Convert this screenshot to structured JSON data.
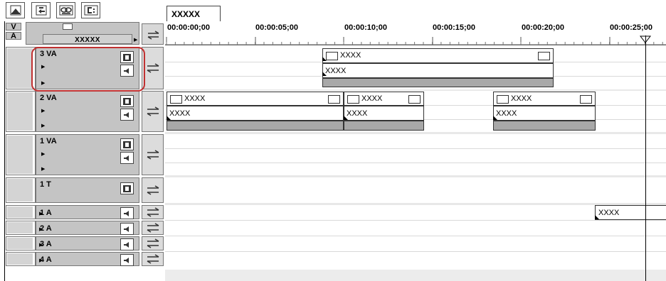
{
  "sequence_tab": "XXXXX",
  "header": {
    "v_label": "V",
    "a_label": "A",
    "track_name": "XXXXX"
  },
  "ruler": {
    "timecodes": [
      "00:00:00;00",
      "00:00:05;00",
      "00:00:10;00",
      "00:00:15;00",
      "00:00:20;00",
      "00:00:25;00"
    ]
  },
  "tracks": {
    "va3": "3 VA",
    "va2": "2 VA",
    "va1": "1 VA",
    "t1": "1 T",
    "a1": "1 A",
    "a2": "2 A",
    "a3": "3 A",
    "a4": "4 A"
  },
  "clips": {
    "va3_clip_top": "XXXX",
    "va3_clip_bottom": "XXXX",
    "va2_clip1_top": "XXXX",
    "va2_clip1_bottom": "XXXX",
    "va2_clip2_top": "XXXX",
    "va2_clip2_bottom": "XXXX",
    "va2_clip3_top": "XXXX",
    "va2_clip3_bottom": "XXXX",
    "a1_clip": "XXXX"
  },
  "icons": {
    "toolbar": [
      "track-expand-icon",
      "add-track-icon",
      "link-icon",
      "drive-icon"
    ],
    "track_video": "film-strip-icon",
    "track_audio": "speaker-icon",
    "swap": "swap-arrows-icon"
  }
}
